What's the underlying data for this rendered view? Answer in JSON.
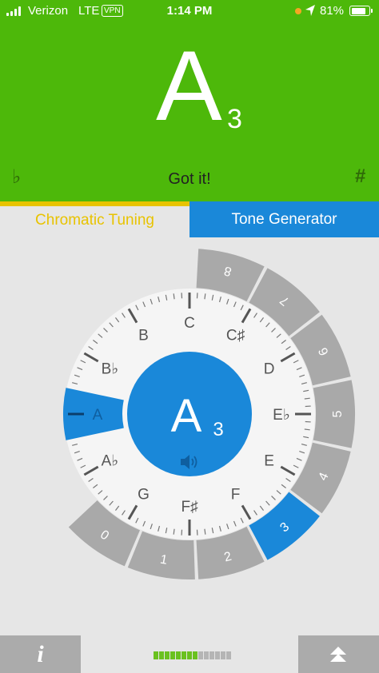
{
  "status_bar": {
    "carrier": "Verizon",
    "network": "LTE",
    "vpn": "VPN",
    "time": "1:14 PM",
    "battery": "81%"
  },
  "header": {
    "note": "A",
    "octave": "3",
    "flat_symbol": "♭",
    "sharp_symbol": "#",
    "message": "Got it!",
    "background_color": "#4db80a"
  },
  "tabs": [
    {
      "label": "Chromatic Tuning",
      "active": true,
      "color": "#e8c300"
    },
    {
      "label": "Tone Generator",
      "active": false,
      "color": "#1a88d9"
    }
  ],
  "dial": {
    "notes": [
      "C",
      "C♯",
      "D",
      "E♭",
      "E",
      "F",
      "F♯",
      "G",
      "A♭",
      "A",
      "B♭",
      "B"
    ],
    "selected_note": "A",
    "center_note": "A",
    "center_octave": "3",
    "center_icon": "speaker-icon",
    "octaves": [
      "0",
      "1",
      "2",
      "3",
      "4",
      "5",
      "6",
      "7",
      "8"
    ],
    "selected_octave": "3",
    "accent_color": "#1a88d9"
  },
  "bottom_bar": {
    "info_label": "i",
    "info_icon": "info-icon",
    "expand_icon": "double-chevron-up-icon",
    "level_meter": {
      "segments": 14,
      "lit": 8,
      "lit_color": "#6ac11f",
      "off_color": "#b5b5b5"
    }
  }
}
